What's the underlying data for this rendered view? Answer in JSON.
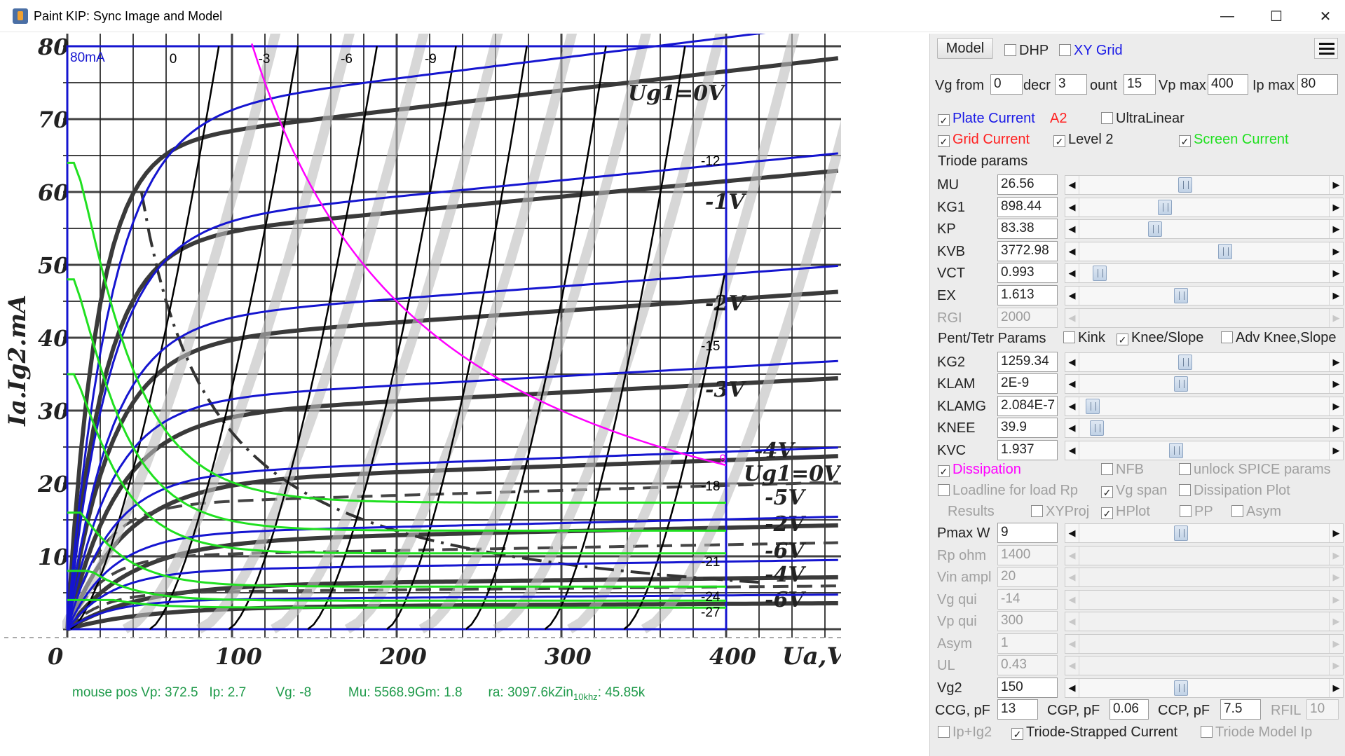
{
  "window": {
    "title": "Paint KIP: Sync Image and Model",
    "minimize_glyph": "—",
    "maximize_glyph": "☐",
    "close_glyph": "✕",
    "app_icon": "java-cup-icon"
  },
  "plot": {
    "current_scale_label": "80mA",
    "y_axis_title": "Ia.Ig2.mA",
    "x_axis_title": "Ua,V",
    "y_ticks": [
      "80",
      "70",
      "60",
      "50",
      "40",
      "30",
      "20",
      "10"
    ],
    "x_ticks": [
      "0",
      "100",
      "200",
      "300",
      "400"
    ],
    "model_grid_labels": [
      "0",
      "-3",
      "-6",
      "-9",
      "-12",
      "-15",
      "-18",
      "-21",
      "-24",
      "-27"
    ],
    "dissipation_label": "9",
    "datasheet_labels": [
      "Ug1=0V",
      "-1V",
      "-2V",
      "-3V",
      "-4V",
      "Ug1=0V",
      "-5V",
      "-2V",
      "-6V",
      "-4V",
      "-6V"
    ],
    "status_line": "mouse pos Vp: 372.5   Ip: 2.7        Vg: -8          Mu: 5568.9Gm: 1.8       ra: 3097.6kZin",
    "status_sub": "10khz",
    "status_tail": ": 45.85k"
  },
  "panel": {
    "model_button": "Model",
    "dhp_label": "DHP",
    "xygrid_label": "XY Grid",
    "menu_icon": "hamburger-menu-icon",
    "vg_from_label": "Vg from",
    "vg_from_value": "0",
    "decr_label": "decr",
    "decr_value": "3",
    "count_label": "ount",
    "count_value": "15",
    "vpmax_label": "Vp max",
    "vpmax_value": "400",
    "ipmax_label": "Ip max",
    "ipmax_value": "80",
    "plate_current": "Plate Current",
    "a2_label": "A2",
    "ultralinear": "UltraLinear",
    "grid_current": "Grid Current",
    "level2": "Level 2",
    "screen_current": "Screen Current",
    "triode_params_header": "Triode params",
    "triode_params": [
      {
        "label": "MU",
        "value": "26.56",
        "pos": 0.42,
        "enabled": true
      },
      {
        "label": "KG1",
        "value": "898.44",
        "pos": 0.33,
        "enabled": true
      },
      {
        "label": "KP",
        "value": "83.38",
        "pos": 0.29,
        "enabled": true
      },
      {
        "label": "KVB",
        "value": "3772.98",
        "pos": 0.59,
        "enabled": true
      },
      {
        "label": "VCT",
        "value": "0.993",
        "pos": 0.05,
        "enabled": true
      },
      {
        "label": "EX",
        "value": "1.613",
        "pos": 0.4,
        "enabled": true
      },
      {
        "label": "RGI",
        "value": "2000",
        "pos": null,
        "enabled": false
      }
    ],
    "pent_header": "Pent/Tetr Params",
    "kink_label": "Kink",
    "knee_slope_label": "Knee/Slope",
    "adv_knee_label": "Adv Knee,Slope",
    "pent_params": [
      {
        "label": "KG2",
        "value": "1259.34",
        "pos": 0.42,
        "enabled": true
      },
      {
        "label": "KLAM",
        "value": "2E-9",
        "pos": 0.4,
        "enabled": true
      },
      {
        "label": "KLAMG",
        "value": "2.084E-7",
        "pos": 0.02,
        "enabled": true
      },
      {
        "label": "KNEE",
        "value": "39.9",
        "pos": 0.04,
        "enabled": true
      },
      {
        "label": "KVC",
        "value": "1.937",
        "pos": 0.38,
        "enabled": true
      }
    ],
    "dissipation": "Dissipation",
    "nfb": "NFB",
    "unlock_spice": "unlock SPICE params",
    "loadline": "Loadline for load Rp",
    "vg_span": "Vg span",
    "dissipation_plot": "Dissipation Plot",
    "results": "Results",
    "xyproj": "XYProj",
    "hplot": "HPlot",
    "pp": "PP",
    "asym_cb": "Asym",
    "load_params": [
      {
        "label": "Pmax W",
        "value": "9",
        "pos": 0.4,
        "enabled": true
      },
      {
        "label": "Rp ohm",
        "value": "1400",
        "pos": null,
        "enabled": false
      },
      {
        "label": "Vin ampl",
        "value": "20",
        "pos": null,
        "enabled": false
      },
      {
        "label": "Vg qui",
        "value": "-14",
        "pos": null,
        "enabled": false
      },
      {
        "label": "Vp qui",
        "value": "300",
        "pos": null,
        "enabled": false
      },
      {
        "label": "Asym",
        "value": "1",
        "pos": null,
        "enabled": false
      },
      {
        "label": "UL",
        "value": "0.43",
        "pos": null,
        "enabled": false
      },
      {
        "label": "Vg2",
        "value": "150",
        "pos": 0.4,
        "enabled": true
      }
    ],
    "ccg_label": "CCG, pF",
    "ccg_value": "13",
    "cgp_label": "CGP, pF",
    "cgp_value": "0.06",
    "ccp_label": "CCP, pF",
    "ccp_value": "7.5",
    "rfil_label": "RFIL",
    "rfil_value": "10",
    "ip_ig2": "Ip+Ig2",
    "triode_strapped": "Triode-Strapped Current",
    "triode_model_ip": "Triode Model Ip"
  },
  "colors": {
    "plate_current": "#1a1ae6",
    "grid_current": "#ff2020",
    "screen_current": "#20e020",
    "dissipation": "#ff00ff",
    "status_text": "#1f9a4a",
    "model_curve": "#1515d0"
  }
}
